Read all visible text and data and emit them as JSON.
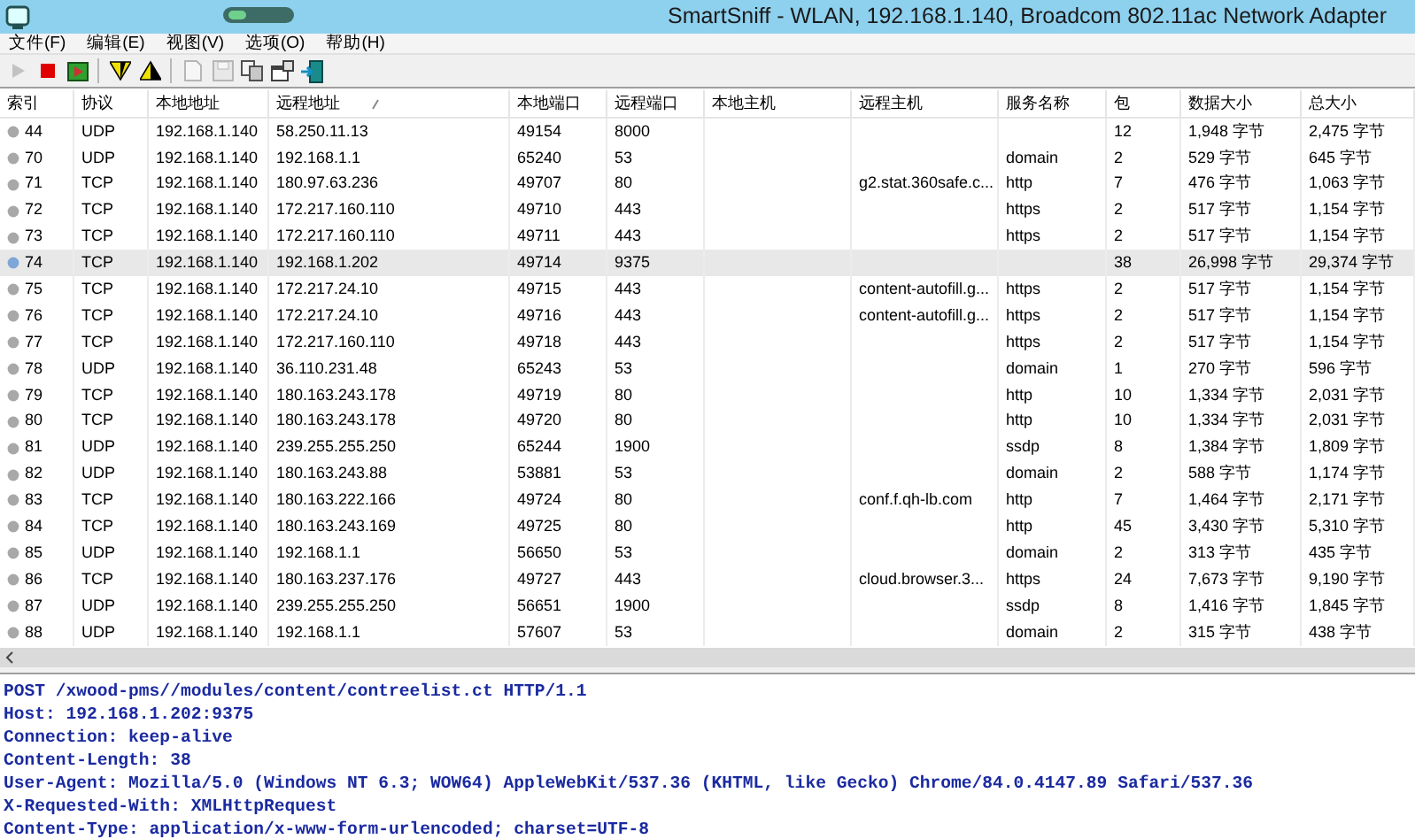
{
  "window": {
    "title": "SmartSniff  -  WLAN, 192.168.1.140, Broadcom 802.11ac Network Adapter"
  },
  "menu": [
    "文件(F)",
    "编辑(E)",
    "视图(V)",
    "选项(O)",
    "帮助(H)"
  ],
  "toolbar": [
    {
      "kind": "play",
      "disabled": true
    },
    {
      "kind": "stop",
      "disabled": false
    },
    {
      "kind": "start",
      "disabled": false
    },
    {
      "kind": "sep"
    },
    {
      "kind": "filter-down",
      "disabled": false
    },
    {
      "kind": "filter-up",
      "disabled": false
    },
    {
      "kind": "sep"
    },
    {
      "kind": "page",
      "disabled": true
    },
    {
      "kind": "save",
      "disabled": true
    },
    {
      "kind": "copy",
      "disabled": false
    },
    {
      "kind": "props",
      "disabled": false
    },
    {
      "kind": "exit",
      "disabled": false
    }
  ],
  "table": {
    "columns": [
      {
        "label": "索引"
      },
      {
        "label": "协议"
      },
      {
        "label": "本地地址"
      },
      {
        "label": "远程地址",
        "sorted": true
      },
      {
        "label": "本地端口"
      },
      {
        "label": "远程端口"
      },
      {
        "label": "本地主机"
      },
      {
        "label": "远程主机"
      },
      {
        "label": "服务名称"
      },
      {
        "label": "包"
      },
      {
        "label": "数据大小"
      },
      {
        "label": "总大小"
      }
    ],
    "rows": [
      {
        "selected": false,
        "index": "44",
        "protocol": "UDP",
        "local_address": "192.168.1.140",
        "remote_address": "58.250.11.13",
        "local_port": "49154",
        "remote_port": "8000",
        "packets": "12",
        "data_size": "1,948 字节",
        "total_size": "2,475 字节"
      },
      {
        "selected": false,
        "index": "70",
        "protocol": "UDP",
        "local_address": "192.168.1.140",
        "remote_address": "192.168.1.1",
        "local_port": "65240",
        "remote_port": "53",
        "service": "domain",
        "packets": "2",
        "data_size": "529 字节",
        "total_size": "645 字节"
      },
      {
        "selected": false,
        "index": "71",
        "protocol": "TCP",
        "local_address": "192.168.1.140",
        "remote_address": "180.97.63.236",
        "local_port": "49707",
        "remote_port": "80",
        "remote_host": "g2.stat.360safe.c...",
        "service": "http",
        "packets": "7",
        "data_size": "476 字节",
        "total_size": "1,063 字节"
      },
      {
        "selected": false,
        "index": "72",
        "protocol": "TCP",
        "local_address": "192.168.1.140",
        "remote_address": "172.217.160.110",
        "local_port": "49710",
        "remote_port": "443",
        "service": "https",
        "packets": "2",
        "data_size": "517 字节",
        "total_size": "1,154 字节"
      },
      {
        "selected": false,
        "index": "73",
        "protocol": "TCP",
        "local_address": "192.168.1.140",
        "remote_address": "172.217.160.110",
        "local_port": "49711",
        "remote_port": "443",
        "service": "https",
        "packets": "2",
        "data_size": "517 字节",
        "total_size": "1,154 字节"
      },
      {
        "selected": true,
        "index": "74",
        "protocol": "TCP",
        "local_address": "192.168.1.140",
        "remote_address": "192.168.1.202",
        "local_port": "49714",
        "remote_port": "9375",
        "packets": "38",
        "data_size": "26,998 字节",
        "total_size": "29,374 字节"
      },
      {
        "selected": false,
        "index": "75",
        "protocol": "TCP",
        "local_address": "192.168.1.140",
        "remote_address": "172.217.24.10",
        "local_port": "49715",
        "remote_port": "443",
        "remote_host": "content-autofill.g...",
        "service": "https",
        "packets": "2",
        "data_size": "517 字节",
        "total_size": "1,154 字节"
      },
      {
        "selected": false,
        "index": "76",
        "protocol": "TCP",
        "local_address": "192.168.1.140",
        "remote_address": "172.217.24.10",
        "local_port": "49716",
        "remote_port": "443",
        "remote_host": "content-autofill.g...",
        "service": "https",
        "packets": "2",
        "data_size": "517 字节",
        "total_size": "1,154 字节"
      },
      {
        "selected": false,
        "index": "77",
        "protocol": "TCP",
        "local_address": "192.168.1.140",
        "remote_address": "172.217.160.110",
        "local_port": "49718",
        "remote_port": "443",
        "service": "https",
        "packets": "2",
        "data_size": "517 字节",
        "total_size": "1,154 字节"
      },
      {
        "selected": false,
        "index": "78",
        "protocol": "UDP",
        "local_address": "192.168.1.140",
        "remote_address": "36.110.231.48",
        "local_port": "65243",
        "remote_port": "53",
        "service": "domain",
        "packets": "1",
        "data_size": "270 字节",
        "total_size": "596 字节"
      },
      {
        "selected": false,
        "index": "79",
        "protocol": "TCP",
        "local_address": "192.168.1.140",
        "remote_address": "180.163.243.178",
        "local_port": "49719",
        "remote_port": "80",
        "service": "http",
        "packets": "10",
        "data_size": "1,334 字节",
        "total_size": "2,031 字节"
      },
      {
        "selected": false,
        "index": "80",
        "protocol": "TCP",
        "local_address": "192.168.1.140",
        "remote_address": "180.163.243.178",
        "local_port": "49720",
        "remote_port": "80",
        "service": "http",
        "packets": "10",
        "data_size": "1,334 字节",
        "total_size": "2,031 字节"
      },
      {
        "selected": false,
        "index": "81",
        "protocol": "UDP",
        "local_address": "192.168.1.140",
        "remote_address": "239.255.255.250",
        "local_port": "65244",
        "remote_port": "1900",
        "service": "ssdp",
        "packets": "8",
        "data_size": "1,384 字节",
        "total_size": "1,809 字节"
      },
      {
        "selected": false,
        "index": "82",
        "protocol": "UDP",
        "local_address": "192.168.1.140",
        "remote_address": "180.163.243.88",
        "local_port": "53881",
        "remote_port": "53",
        "service": "domain",
        "packets": "2",
        "data_size": "588 字节",
        "total_size": "1,174 字节"
      },
      {
        "selected": false,
        "index": "83",
        "protocol": "TCP",
        "local_address": "192.168.1.140",
        "remote_address": "180.163.222.166",
        "local_port": "49724",
        "remote_port": "80",
        "remote_host": "conf.f.qh-lb.com",
        "service": "http",
        "packets": "7",
        "data_size": "1,464 字节",
        "total_size": "2,171 字节"
      },
      {
        "selected": false,
        "index": "84",
        "protocol": "TCP",
        "local_address": "192.168.1.140",
        "remote_address": "180.163.243.169",
        "local_port": "49725",
        "remote_port": "80",
        "service": "http",
        "packets": "45",
        "data_size": "3,430 字节",
        "total_size": "5,310 字节"
      },
      {
        "selected": false,
        "index": "85",
        "protocol": "UDP",
        "local_address": "192.168.1.140",
        "remote_address": "192.168.1.1",
        "local_port": "56650",
        "remote_port": "53",
        "service": "domain",
        "packets": "2",
        "data_size": "313 字节",
        "total_size": "435 字节"
      },
      {
        "selected": false,
        "index": "86",
        "protocol": "TCP",
        "local_address": "192.168.1.140",
        "remote_address": "180.163.237.176",
        "local_port": "49727",
        "remote_port": "443",
        "remote_host": "cloud.browser.3...",
        "service": "https",
        "packets": "24",
        "data_size": "7,673 字节",
        "total_size": "9,190 字节"
      },
      {
        "selected": false,
        "index": "87",
        "protocol": "UDP",
        "local_address": "192.168.1.140",
        "remote_address": "239.255.255.250",
        "local_port": "56651",
        "remote_port": "1900",
        "service": "ssdp",
        "packets": "8",
        "data_size": "1,416 字节",
        "total_size": "1,845 字节"
      },
      {
        "selected": false,
        "index": "88",
        "protocol": "UDP",
        "local_address": "192.168.1.140",
        "remote_address": "192.168.1.1",
        "local_port": "57607",
        "remote_port": "53",
        "service": "domain",
        "packets": "2",
        "data_size": "315 字节",
        "total_size": "438 字节"
      }
    ]
  },
  "detail": [
    "POST /xwood-pms//modules/content/contreelist.ct HTTP/1.1",
    "Host: 192.168.1.202:9375",
    "Connection: keep-alive",
    "Content-Length: 38",
    "User-Agent: Mozilla/5.0 (Windows NT 6.3; WOW64) AppleWebKit/537.36 (KHTML, like Gecko) Chrome/84.0.4147.89 Safari/537.36",
    "X-Requested-With: XMLHttpRequest",
    "Content-Type: application/x-www-form-urlencoded; charset=UTF-8"
  ]
}
